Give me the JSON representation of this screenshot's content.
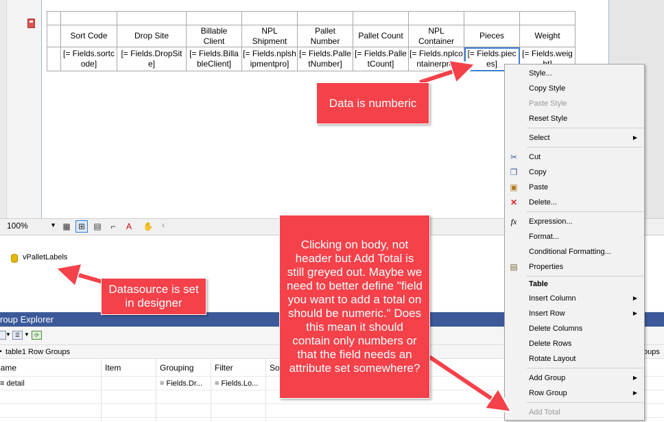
{
  "table": {
    "headers": [
      "Sort Code",
      "Drop Site",
      "Billable Client",
      "NPL Shipment",
      "Pallet Number",
      "Pallet Count",
      "NPL Container",
      "Pieces",
      "Weight"
    ],
    "fields": [
      "[= Fields.sortcode]",
      "[= Fields.DropSite]",
      "[= Fields.BillableClient]",
      "[= Fields.nplshipmentpro]",
      "[= Fields.PalletNumber]",
      "[= Fields.PalletCount]",
      "[= Fields.nplcontainerpro]",
      "[= Fields.pieces]",
      "[= Fields.weight]"
    ]
  },
  "zoombar": {
    "zoom": "100%",
    "scroll_left": "‹"
  },
  "datasource": {
    "name": "vPalletLabels"
  },
  "group_explorer": {
    "title": "roup Explorer",
    "row_groups": "table1 Row Groups",
    "col_groups_partial": "oups",
    "columns": [
      "lame",
      "Item",
      "Grouping",
      "Filter",
      "So"
    ],
    "row": {
      "name": "≡ detail",
      "item": "",
      "grouping": "= Fields.Dr...",
      "filter": "= Fields.Lo...",
      "sort": ""
    }
  },
  "menu": {
    "items": [
      {
        "label": "Style...",
        "disabled": false
      },
      {
        "label": "Copy Style",
        "disabled": false
      },
      {
        "label": "Paste Style",
        "disabled": true
      },
      {
        "label": "Reset Style",
        "disabled": false
      },
      {
        "label": "Select",
        "disabled": false,
        "submenu": true
      },
      {
        "label": "Cut",
        "disabled": false,
        "icon": "scissors-icon"
      },
      {
        "label": "Copy",
        "disabled": false,
        "icon": "copy-icon"
      },
      {
        "label": "Paste",
        "disabled": false,
        "icon": "paste-icon"
      },
      {
        "label": "Delete...",
        "disabled": false,
        "icon": "delete-icon"
      },
      {
        "label": "Expression...",
        "disabled": false,
        "icon": "fx-icon"
      },
      {
        "label": "Format...",
        "disabled": false
      },
      {
        "label": "Conditional Formatting...",
        "disabled": false
      },
      {
        "label": "Properties",
        "disabled": false,
        "icon": "properties-icon"
      },
      {
        "label": "Table",
        "disabled": false,
        "bold": true
      },
      {
        "label": "Insert Column",
        "disabled": false,
        "submenu": true
      },
      {
        "label": "Insert Row",
        "disabled": false,
        "submenu": true
      },
      {
        "label": "Delete Columns",
        "disabled": false
      },
      {
        "label": "Delete Rows",
        "disabled": false
      },
      {
        "label": "Rotate Layout",
        "disabled": false
      },
      {
        "label": "Add Group",
        "disabled": false,
        "submenu": true
      },
      {
        "label": "Row Group",
        "disabled": false,
        "submenu": true
      },
      {
        "label": "Add Total",
        "disabled": true
      }
    ],
    "fx_glyph": "fx",
    "submenu_glyph": "▶"
  },
  "callouts": {
    "numeric": "Data is numberic",
    "datasource": "Datasource is set in designer",
    "question": "Clicking on body, not header but Add Total is still greyed out.  Maybe we need to better define \"field you want to add a total on should be numeric.\"  Does this mean it should contain only numbers or that the field needs an attribute set somewhere?"
  },
  "colors": {
    "callout": "#f4414a",
    "title_bar": "#3c5a99",
    "selection": "#3a7fd0"
  }
}
